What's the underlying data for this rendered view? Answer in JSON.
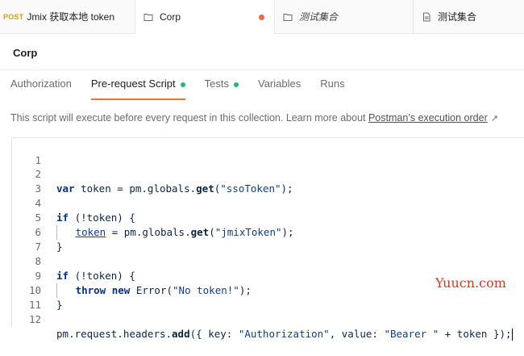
{
  "tabs": [
    {
      "method": "POST",
      "label": "Jmix 获取本地 token",
      "icon": "request-icon"
    },
    {
      "label": "Corp",
      "icon": "collection-icon",
      "unsaved": true
    },
    {
      "label": "测试集合",
      "icon": "collection-icon",
      "italic": true
    },
    {
      "label": "测试集合",
      "icon": "document-icon"
    }
  ],
  "title": "Corp",
  "subtabs": [
    {
      "label": "Authorization"
    },
    {
      "label": "Pre-request Script",
      "dot": true,
      "active": true
    },
    {
      "label": "Tests",
      "dot": true
    },
    {
      "label": "Variables"
    },
    {
      "label": "Runs"
    }
  ],
  "description": {
    "text": "This script will execute before every request in this collection. Learn more about ",
    "link": "Postman’s execution order",
    "ext_icon": "↗"
  },
  "editor": {
    "line_numbers": [
      "1",
      "2",
      "3",
      "4",
      "5",
      "6",
      "7",
      "8",
      "9",
      "10",
      "11",
      "12"
    ],
    "lines": [
      "",
      "var token = pm.globals.get(\"ssoToken\");",
      "",
      "if (!token) {",
      "    token = pm.globals.get(\"jmixToken\");",
      "}",
      "",
      "if (!token) {",
      "    throw new Error(\"No token!\");",
      "}",
      "",
      "pm.request.headers.add({ key: \"Authorization\", value: \"Bearer \" + token });"
    ]
  },
  "watermark": "Yuucn.com",
  "colors": {
    "accent": "#ff6c37",
    "status_green": "#26b47f",
    "unsaved_dot": "#ee6b46",
    "method_post": "#d4a017"
  }
}
